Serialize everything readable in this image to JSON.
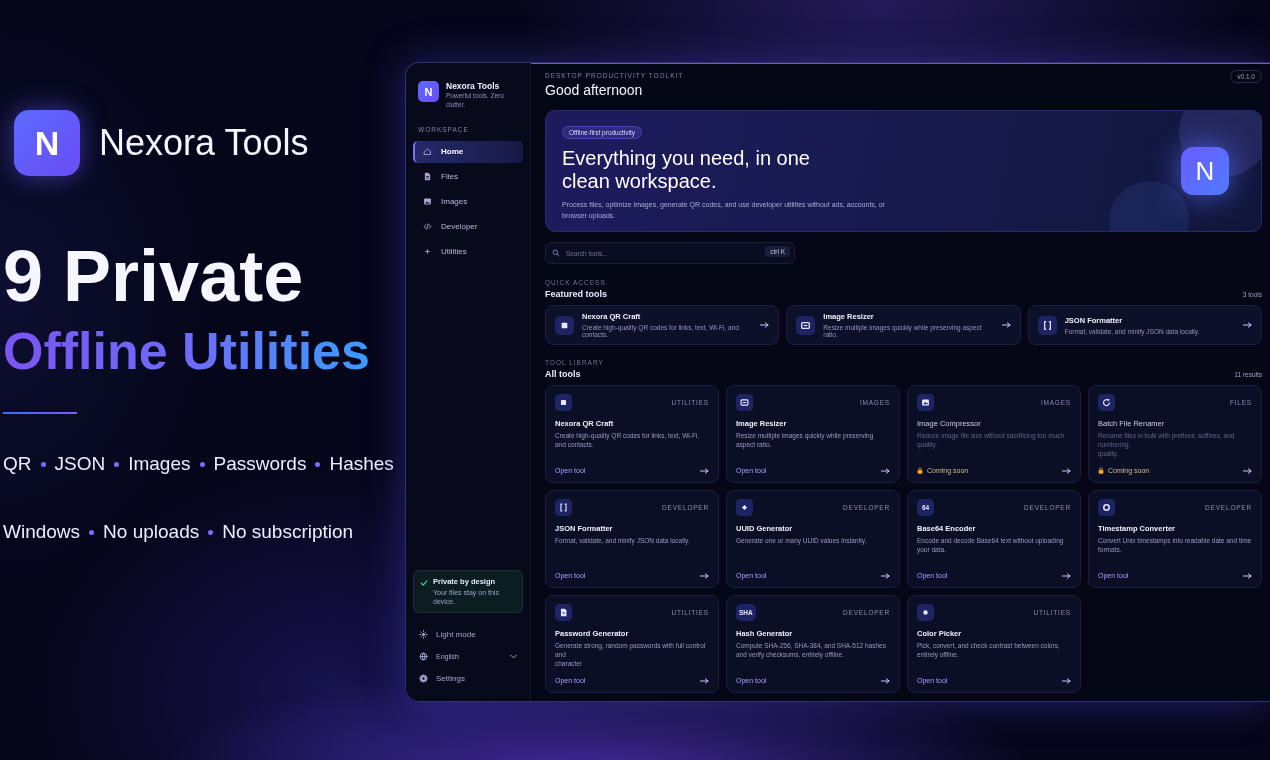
{
  "promo": {
    "logo_letter": "N",
    "name": "Nexora Tools",
    "headline": "9 Private",
    "subheadline": "Offline Utilities",
    "feature_rows": [
      {
        "items": [
          "QR",
          "JSON",
          "Images",
          "Passwords",
          "Hashes"
        ]
      },
      {
        "items": [
          "Windows",
          "No uploads",
          "No subscription"
        ]
      }
    ]
  },
  "app": {
    "sidebar": {
      "logo_letter": "N",
      "title": "Nexora Tools",
      "tagline": "Powerful tools. Zero clutter.",
      "section": "WORKSPACE",
      "items": [
        {
          "label": "Home",
          "kind": "home",
          "selected": true
        },
        {
          "label": "Files",
          "kind": "files",
          "selected": false
        },
        {
          "label": "Images",
          "kind": "images",
          "selected": false
        },
        {
          "label": "Developer",
          "kind": "developer",
          "selected": false
        },
        {
          "label": "Utilities",
          "kind": "utilities",
          "selected": false
        }
      ],
      "privacy": {
        "title": "Private by design",
        "text": "Your files stay on this device."
      },
      "footer": [
        {
          "kind": "toggle",
          "label": "Light mode"
        },
        {
          "kind": "select",
          "label": "English"
        },
        {
          "kind": "link",
          "label": "Settings"
        }
      ]
    },
    "main": {
      "version": "v0.1.0",
      "kicker": "DESKTOP PRODUCTIVITY TOOLKIT",
      "greeting": "Good afternoon",
      "hero": {
        "badge": "Offline-first productivity",
        "title": "Everything you need, in one clean workspace.",
        "text": "Process files, optimize images, generate QR codes, and use developer utilities without ads, accounts, or browser uploads.",
        "logo_letter": "N"
      },
      "search": {
        "placeholder": "Search tools...",
        "shortcut": "ctrl K"
      },
      "featured": {
        "kicker": "QUICK ACCESS",
        "title": "Featured tools",
        "count": "3 tools",
        "tools": [
          {
            "kind": "qr",
            "name": "Nexora QR Craft",
            "description": "Create high-quality QR codes for links, text, Wi-Fi, and contacts."
          },
          {
            "kind": "resize",
            "name": "Image Resizer",
            "description": "Resize multiple images quickly while preserving aspect ratio."
          },
          {
            "kind": "json",
            "name": "JSON Formatter",
            "description": "Format, validate, and minify JSON data locally."
          }
        ]
      },
      "library": {
        "kicker": "TOOL LIBRARY",
        "title": "All tools",
        "count": "11 results",
        "tools": [
          {
            "kind": "qr",
            "category": "UTILITIES",
            "name": "Nexora QR Craft",
            "description": "Create high-quality QR codes for links, text, Wi-Fi, and contacts.",
            "action": "Open tool",
            "locked": false
          },
          {
            "kind": "resize",
            "category": "IMAGES",
            "name": "Image Resizer",
            "description": "Resize multiple images quickly while preserving aspect ratio.",
            "action": "Open tool",
            "locked": false
          },
          {
            "kind": "compress",
            "category": "IMAGES",
            "name": "Image Compressor",
            "description": "Reduce image file size without sacrificing too much quality.",
            "action": "Coming soon",
            "locked": true
          },
          {
            "kind": "rename",
            "category": "FILES",
            "name": "Batch File Renamer",
            "description": "Rename files in bulk with prefixes, suffixes, and numbering.",
            "note": "quality.",
            "action": "Coming soon",
            "locked": true
          },
          {
            "kind": "json",
            "category": "DEVELOPER",
            "name": "JSON Formatter",
            "description": "Format, validate, and minify JSON data locally.",
            "action": "Open tool",
            "locked": false
          },
          {
            "kind": "uuid",
            "category": "DEVELOPER",
            "name": "UUID Generator",
            "description": "Generate one or many UUID values instantly.",
            "action": "Open tool",
            "locked": false
          },
          {
            "icon_text": "64",
            "category": "DEVELOPER",
            "name": "Base64 Encoder",
            "description": "Encode and decode Base64 text without uploading your data.",
            "action": "Open tool",
            "locked": false
          },
          {
            "kind": "time",
            "category": "DEVELOPER",
            "name": "Timestamp Converter",
            "description": "Convert Unix timestamps into readable date and time formats.",
            "action": "Open tool",
            "locked": false
          },
          {
            "kind": "password",
            "category": "UTILITIES",
            "name": "Password Generator",
            "description": "Generate strong, random passwords with full control and",
            "note": "character",
            "action": "Open tool",
            "locked": false
          },
          {
            "icon_text": "SHA",
            "category": "DEVELOPER",
            "name": "Hash Generator",
            "description": "Compute SHA-256, SHA-384, and SHA-512 hashes and verify checksums, entirely offline.",
            "action": "Open tool",
            "locked": false
          },
          {
            "kind": "color",
            "category": "UTILITIES",
            "name": "Color Picker",
            "description": "Pick, convert, and check contrast between colors, entirely offline.",
            "action": "Open tool",
            "locked": false
          }
        ]
      }
    }
  }
}
